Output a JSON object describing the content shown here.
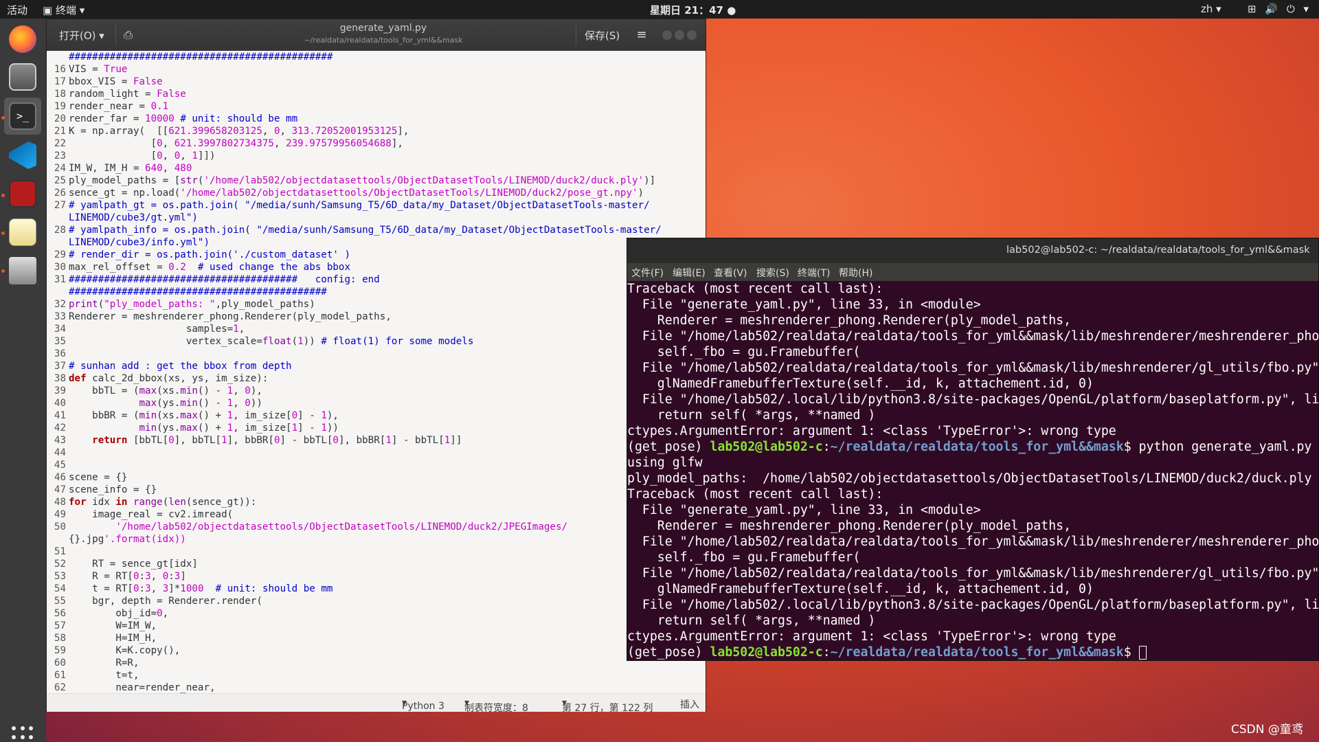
{
  "topbar": {
    "activities": "活动",
    "app_menu": "终端",
    "clock": "星期日 21：47",
    "lang": "zh"
  },
  "gedit": {
    "open_label": "打开(O)",
    "title": "generate_yaml.py",
    "path": "~/realdata/realdata/tools_for_yml&&mask",
    "save_label": "保存(S)",
    "status": {
      "language": "Python 3",
      "tab_width": "制表符宽度：8",
      "position": "第 27 行，第 122 列",
      "mode": "插入"
    },
    "lines": [
      {
        "n": "",
        "t": "#############################################"
      },
      {
        "n": "16",
        "t": "VIS = True"
      },
      {
        "n": "17",
        "t": "bbox_VIS = False"
      },
      {
        "n": "18",
        "t": "random_light = False"
      },
      {
        "n": "19",
        "t": "render_near = 0.1"
      },
      {
        "n": "20",
        "t": "render_far = 10000 # unit: should be mm"
      },
      {
        "n": "21",
        "t": "K = np.array(  [[621.399658203125, 0, 313.72052001953125],"
      },
      {
        "n": "22",
        "t": "              [0, 621.3997802734375, 239.97579956054688],"
      },
      {
        "n": "23",
        "t": "              [0, 0, 1]])"
      },
      {
        "n": "24",
        "t": "IM_W, IM_H = 640, 480"
      },
      {
        "n": "25",
        "t": "ply_model_paths = [str('/home/lab502/objectdatasettools/ObjectDatasetTools/LINEMOD/duck2/duck.ply')]"
      },
      {
        "n": "26",
        "t": "sence_gt = np.load('/home/lab502/objectdatasettools/ObjectDatasetTools/LINEMOD/duck2/pose_gt.npy')"
      },
      {
        "n": "27",
        "t": "# yamlpath_gt = os.path.join( \"/media/sunh/Samsung_T5/6D_data/my_Dataset/ObjectDatasetTools-master/"
      },
      {
        "n": "",
        "t": "LINEMOD/cube3/gt.yml\")"
      },
      {
        "n": "28",
        "t": "# yamlpath_info = os.path.join( \"/media/sunh/Samsung_T5/6D_data/my_Dataset/ObjectDatasetTools-master/"
      },
      {
        "n": "",
        "t": "LINEMOD/cube3/info.yml\")"
      },
      {
        "n": "29",
        "t": "# render_dir = os.path.join('./custom_dataset' )"
      },
      {
        "n": "30",
        "t": "max_rel_offset = 0.2  # used change the abs bbox"
      },
      {
        "n": "31",
        "t": "#######################################   config: end"
      },
      {
        "n": "",
        "t": "############################################"
      },
      {
        "n": "32",
        "t": "print(\"ply_model_paths: \",ply_model_paths)"
      },
      {
        "n": "33",
        "t": "Renderer = meshrenderer_phong.Renderer(ply_model_paths,"
      },
      {
        "n": "34",
        "t": "                    samples=1,"
      },
      {
        "n": "35",
        "t": "                    vertex_scale=float(1)) # float(1) for some models"
      },
      {
        "n": "36",
        "t": ""
      },
      {
        "n": "37",
        "t": "# sunhan add : get the bbox from depth"
      },
      {
        "n": "38",
        "t": "def calc_2d_bbox(xs, ys, im_size):"
      },
      {
        "n": "39",
        "t": "    bbTL = (max(xs.min() - 1, 0),"
      },
      {
        "n": "40",
        "t": "            max(ys.min() - 1, 0))"
      },
      {
        "n": "41",
        "t": "    bbBR = (min(xs.max() + 1, im_size[0] - 1),"
      },
      {
        "n": "42",
        "t": "            min(ys.max() + 1, im_size[1] - 1))"
      },
      {
        "n": "43",
        "t": "    return [bbTL[0], bbTL[1], bbBR[0] - bbTL[0], bbBR[1] - bbTL[1]]"
      },
      {
        "n": "44",
        "t": ""
      },
      {
        "n": "45",
        "t": ""
      },
      {
        "n": "46",
        "t": "scene = {}"
      },
      {
        "n": "47",
        "t": "scene_info = {}"
      },
      {
        "n": "48",
        "t": "for idx in range(len(sence_gt)):"
      },
      {
        "n": "49",
        "t": "    image_real = cv2.imread("
      },
      {
        "n": "50",
        "t": "        '/home/lab502/objectdatasettools/ObjectDatasetTools/LINEMOD/duck2/JPEGImages/"
      },
      {
        "n": "",
        "t": "{}.jpg'.format(idx))"
      },
      {
        "n": "51",
        "t": ""
      },
      {
        "n": "52",
        "t": "    RT = sence_gt[idx]"
      },
      {
        "n": "53",
        "t": "    R = RT[0:3, 0:3]"
      },
      {
        "n": "54",
        "t": "    t = RT[0:3, 3]*1000  # unit: should be mm"
      },
      {
        "n": "55",
        "t": "    bgr, depth = Renderer.render("
      },
      {
        "n": "56",
        "t": "        obj_id=0,"
      },
      {
        "n": "57",
        "t": "        W=IM_W,"
      },
      {
        "n": "58",
        "t": "        H=IM_H,"
      },
      {
        "n": "59",
        "t": "        K=K.copy(),"
      },
      {
        "n": "60",
        "t": "        R=R,"
      },
      {
        "n": "61",
        "t": "        t=t,"
      },
      {
        "n": "62",
        "t": "        near=render_near,"
      }
    ]
  },
  "terminal": {
    "title": "lab502@lab502-c: ~/realdata/realdata/tools_for_yml&&mask",
    "menu": [
      "文件(F)",
      "编辑(E)",
      "查看(V)",
      "搜索(S)",
      "终端(T)",
      "帮助(H)"
    ],
    "lines": [
      {
        "t": "Traceback (most recent call last):"
      },
      {
        "t": "  File \"generate_yaml.py\", line 33, in <module>"
      },
      {
        "t": "    Renderer = meshrenderer_phong.Renderer(ply_model_paths,"
      },
      {
        "t": "  File \"/home/lab502/realdata/realdata/tools_for_yml&&mask/lib/meshrenderer/meshrenderer_pho"
      },
      {
        "t": "    self._fbo = gu.Framebuffer("
      },
      {
        "t": "  File \"/home/lab502/realdata/realdata/tools_for_yml&&mask/lib/meshrenderer/gl_utils/fbo.py\""
      },
      {
        "t": "    glNamedFramebufferTexture(self.__id, k, attachement.id, 0)"
      },
      {
        "t": "  File \"/home/lab502/.local/lib/python3.8/site-packages/OpenGL/platform/baseplatform.py\", li"
      },
      {
        "t": "    return self( *args, **named )"
      },
      {
        "t": "ctypes.ArgumentError: argument 1: <class 'TypeError'>: wrong type"
      },
      {
        "p": [
          "(get_pose) ",
          "lab502@lab502-c",
          ":",
          "~/realdata/realdata/tools_for_yml&&mask",
          "$ python generate_yaml.py"
        ]
      },
      {
        "t": "using glfw"
      },
      {
        "t": "ply_model_paths:  /home/lab502/objectdatasettools/ObjectDatasetTools/LINEMOD/duck2/duck.ply"
      },
      {
        "t": "Traceback (most recent call last):"
      },
      {
        "t": "  File \"generate_yaml.py\", line 33, in <module>"
      },
      {
        "t": "    Renderer = meshrenderer_phong.Renderer(ply_model_paths,"
      },
      {
        "t": "  File \"/home/lab502/realdata/realdata/tools_for_yml&&mask/lib/meshrenderer/meshrenderer_pho"
      },
      {
        "t": "    self._fbo = gu.Framebuffer("
      },
      {
        "t": "  File \"/home/lab502/realdata/realdata/tools_for_yml&&mask/lib/meshrenderer/gl_utils/fbo.py\""
      },
      {
        "t": "    glNamedFramebufferTexture(self.__id, k, attachement.id, 0)"
      },
      {
        "t": "  File \"/home/lab502/.local/lib/python3.8/site-packages/OpenGL/platform/baseplatform.py\", li"
      },
      {
        "t": "    return self( *args, **named )"
      },
      {
        "t": "ctypes.ArgumentError: argument 1: <class 'TypeError'>: wrong type"
      },
      {
        "p": [
          "(get_pose) ",
          "lab502@lab502-c",
          ":",
          "~/realdata/realdata/tools_for_yml&&mask",
          "$ "
        ],
        "cursor": true
      }
    ]
  },
  "watermark": "CSDN @童鸢",
  "colors": {
    "ubuntu_orange": "#e95420",
    "terminal_bg": "#300a24",
    "prompt_green": "#8ae234",
    "prompt_blue": "#729fcf"
  }
}
